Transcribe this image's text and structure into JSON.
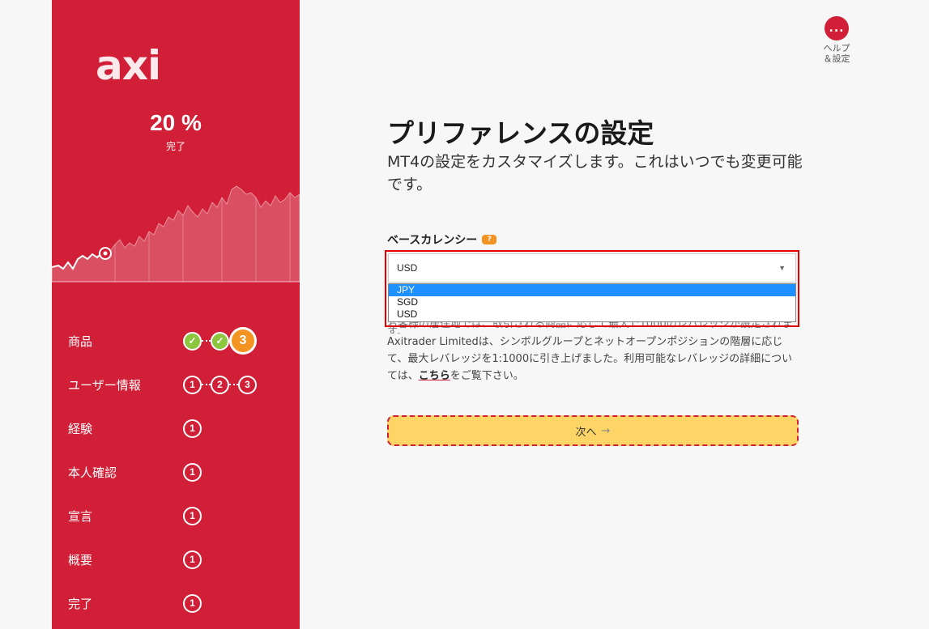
{
  "sidebar": {
    "logo": "axi",
    "progress_pct": "20 %",
    "progress_label": "完了",
    "steps": [
      {
        "label": "商品",
        "dots": [
          "done",
          "done",
          "3"
        ]
      },
      {
        "label": "ユーザー情報",
        "dots": [
          "1",
          "2",
          "3"
        ]
      },
      {
        "label": "経験",
        "dots": [
          "1"
        ]
      },
      {
        "label": "本人確認",
        "dots": [
          "1"
        ]
      },
      {
        "label": "宣言",
        "dots": [
          "1"
        ]
      },
      {
        "label": "概要",
        "dots": [
          "1"
        ]
      },
      {
        "label": "完了",
        "dots": [
          "1"
        ]
      }
    ]
  },
  "help": {
    "icon": "...",
    "label_line1": "ヘルプ",
    "label_line2": "＆設定"
  },
  "main": {
    "title": "プリファレンスの設定",
    "subtitle": "MT4の設定をカスタマイズします。これはいつでも変更可能です。",
    "currency_label": "ベースカレンシー",
    "help_badge": "?",
    "selected_currency": "USD",
    "options": [
      "JPY",
      "SGD",
      "USD"
    ],
    "highlighted_option": "JPY",
    "info_line_partial": "お客様の居住地では、取引される商品に応じて最大1:1000のレバレッジが設定されます。",
    "info_text_1": "Axitrader Limitedは、シンボルグループとネットオープンポジションの階層に応じて、最大レバレッジを1:1000に引き上げました。利用可能なレバレッジの詳細については、",
    "info_link": "こちら",
    "info_text_2": "をご覧下さい。",
    "next_label": "次へ",
    "next_arrow": "→"
  },
  "colors": {
    "brand_red": "#d01f36",
    "done_green": "#8cc63f",
    "current_orange": "#f39322",
    "button_yellow": "#fdd466",
    "highlight_blue": "#1e90ff"
  }
}
